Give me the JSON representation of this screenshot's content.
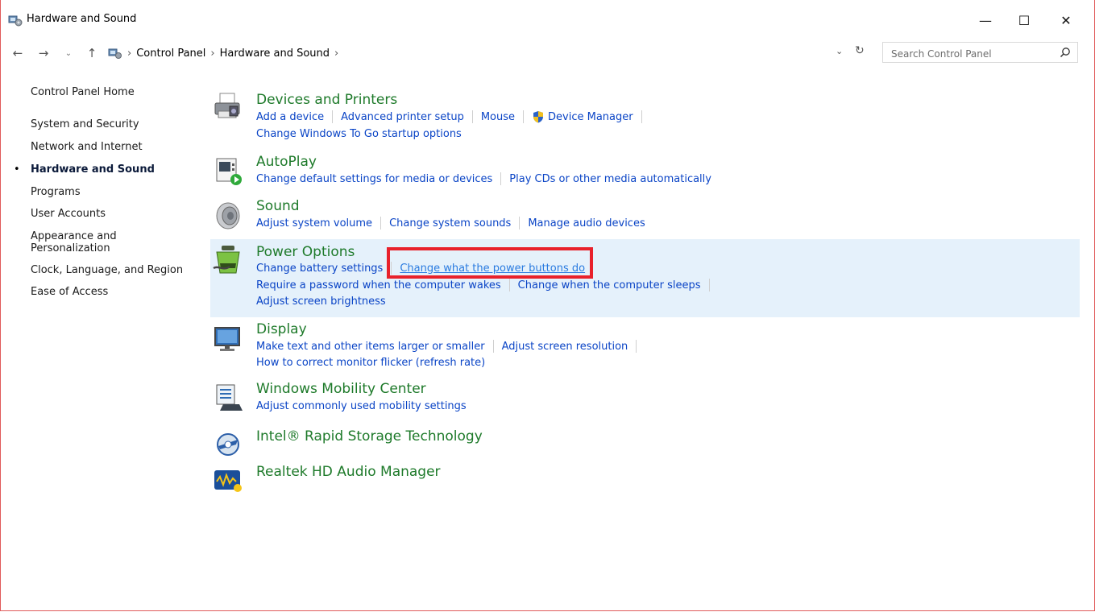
{
  "window": {
    "title": "Hardware and Sound",
    "min_glyph": "—",
    "max_glyph": "☐",
    "close_glyph": "✕"
  },
  "nav": {
    "back_glyph": "←",
    "forward_glyph": "→",
    "recent_glyph": "⌄",
    "up_glyph": "↑",
    "crumbs": [
      "Control Panel",
      "Hardware and Sound"
    ],
    "crumb_sep": "›",
    "dropdown_glyph": "⌄",
    "refresh_glyph": "↻"
  },
  "search": {
    "placeholder": "Search Control Panel"
  },
  "sidebar": {
    "home": "Control Panel Home",
    "items": [
      "System and Security",
      "Network and Internet",
      "Hardware and Sound",
      "Programs",
      "User Accounts",
      "Appearance and",
      "Personalization",
      "Clock, Language, and Region",
      "Ease of Access"
    ],
    "bullet": "•"
  },
  "categories": {
    "devices": {
      "title": "Devices and Printers",
      "links": [
        "Add a device",
        "Advanced printer setup",
        "Mouse",
        "Device Manager"
      ],
      "links2": [
        "Change Windows To Go startup options"
      ]
    },
    "autoplay": {
      "title": "AutoPlay",
      "links": [
        "Change default settings for media or devices",
        "Play CDs or other media automatically"
      ]
    },
    "sound": {
      "title": "Sound",
      "links": [
        "Adjust system volume",
        "Change system sounds",
        "Manage audio devices"
      ]
    },
    "power": {
      "title": "Power Options",
      "links": [
        "Change battery settings",
        "Change what the power buttons do"
      ],
      "links2": [
        "Require a password when the computer wakes",
        "Change when the computer sleeps"
      ],
      "links3": [
        "Adjust screen brightness"
      ]
    },
    "display": {
      "title": "Display",
      "links": [
        "Make text and other items larger or smaller",
        "Adjust screen resolution"
      ],
      "links2": [
        "How to correct monitor flicker (refresh rate)"
      ]
    },
    "mobility": {
      "title": "Windows Mobility Center",
      "links": [
        "Adjust commonly used mobility settings"
      ]
    },
    "intel": {
      "title": "Intel® Rapid Storage Technology"
    },
    "realtek": {
      "title": "Realtek HD Audio Manager"
    }
  },
  "colors": {
    "category_title": "#1e7a2a",
    "link": "#0a44c6",
    "highlight_bg": "#e5f1fb",
    "annotation_box": "#e8212b"
  },
  "icons": {
    "window": "control-panel-icon",
    "devices": "printer-icon",
    "autoplay": "autoplay-icon",
    "sound": "speaker-icon",
    "power": "battery-icon",
    "display": "monitor-icon",
    "mobility": "mobility-center-icon",
    "intel": "intel-rst-icon",
    "realtek": "realtek-audio-icon",
    "shield": "uac-shield-icon"
  }
}
